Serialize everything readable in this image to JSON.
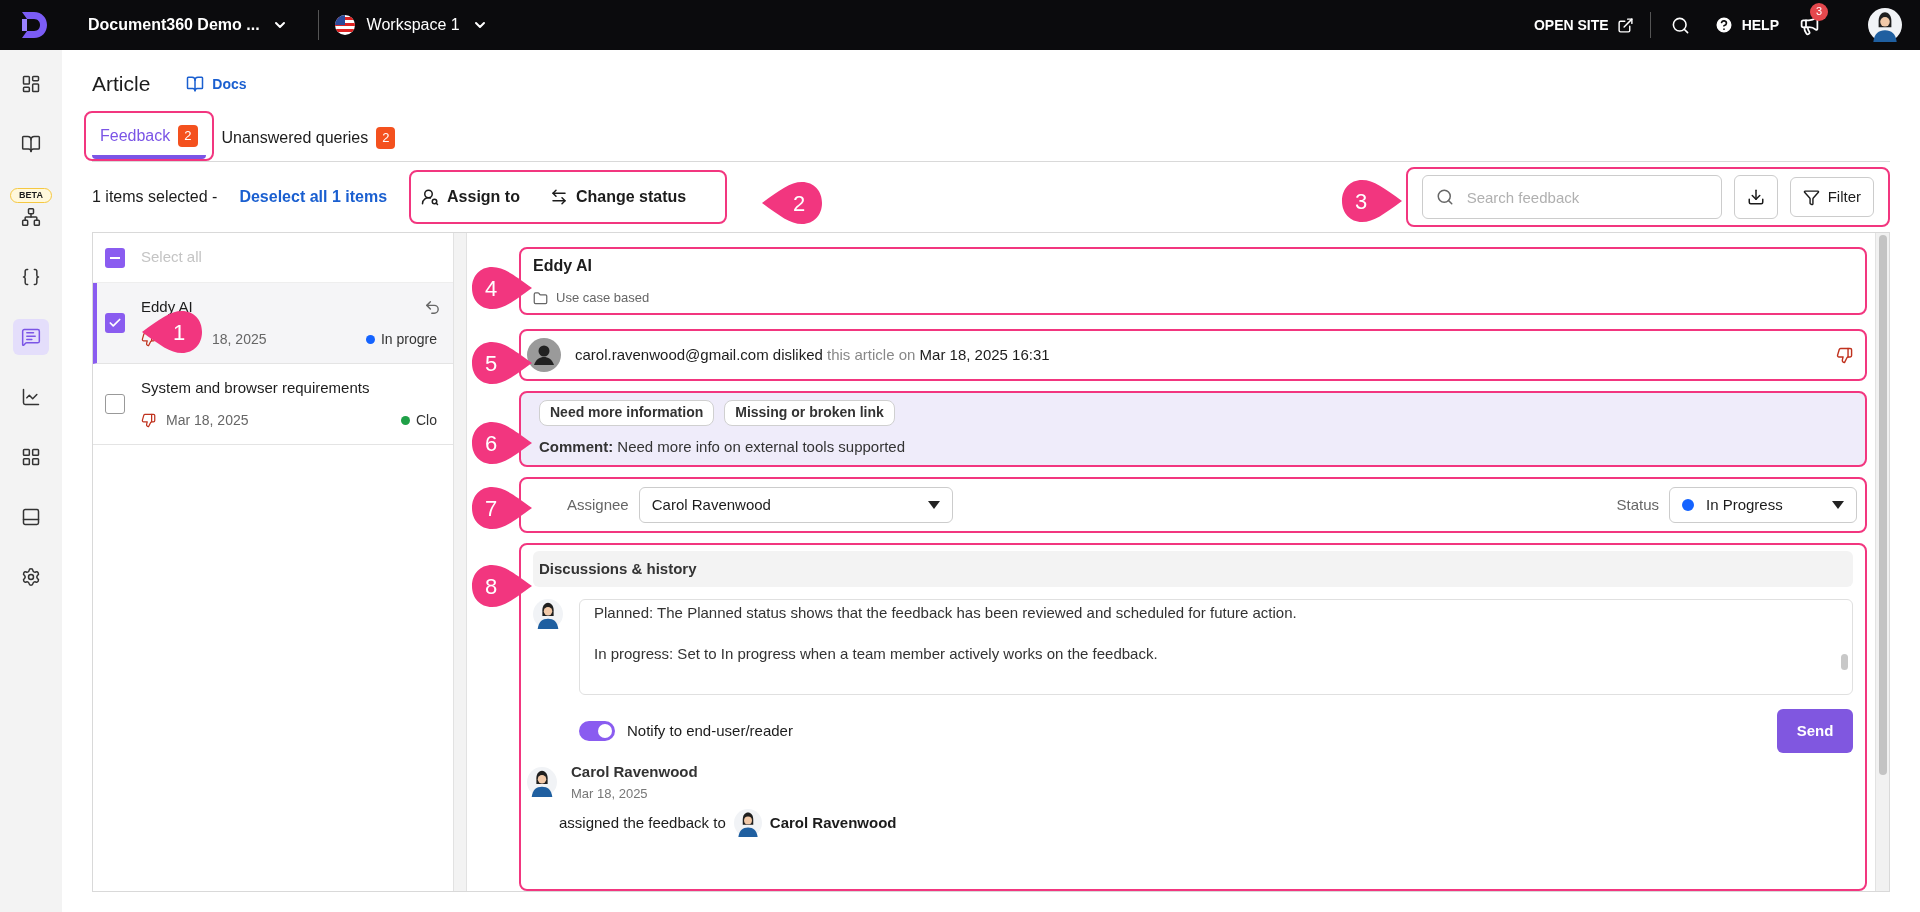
{
  "top_bar": {
    "project": "Document360 Demo ...",
    "workspace": "Workspace 1",
    "open_site": "OPEN SITE",
    "help": "HELP",
    "notifications_badge": "3"
  },
  "sidebar": {
    "beta": "BETA",
    "items": [
      {
        "kind": "dashboard",
        "selected": false
      },
      {
        "kind": "docs",
        "selected": false
      },
      {
        "kind": "workflow",
        "selected": false
      },
      {
        "kind": "api",
        "selected": false
      },
      {
        "kind": "feedback",
        "selected": true
      },
      {
        "kind": "analytics",
        "selected": false
      },
      {
        "kind": "apps",
        "selected": false
      },
      {
        "kind": "widget",
        "selected": false
      },
      {
        "kind": "settings",
        "selected": false
      }
    ]
  },
  "page": {
    "title": "Article",
    "docs_link": "Docs"
  },
  "tabs": [
    {
      "label": "Feedback",
      "count": "2",
      "selected": true,
      "highlighted": true
    },
    {
      "label": "Unanswered queries",
      "count": "2",
      "selected": false,
      "highlighted": false
    }
  ],
  "toolbar": {
    "selection": "1 items selected -",
    "deselect": "Deselect all 1 items",
    "assign": "Assign to",
    "change_status": "Change status",
    "search_placeholder": "Search feedback",
    "filter": "Filter"
  },
  "list": {
    "select_all": "Select all",
    "indeterminate": true,
    "items": [
      {
        "title": "Eddy AI",
        "date": "18, 2025",
        "status": "In progre",
        "color": "#1463ff",
        "checked": true,
        "selected": true
      },
      {
        "title": "System and browser requirements",
        "date": "Mar 18, 2025",
        "status": "Clo",
        "color": "#1fa047",
        "checked": false,
        "selected": false
      }
    ]
  },
  "detail": {
    "title": "Eddy AI",
    "category": "Use case based",
    "reviewer": "carol.ravenwood@gmail.com",
    "action": "disliked",
    "middle": "this article on",
    "datetime": "Mar 18, 2025 16:31",
    "reasons": [
      "Need more information",
      "Missing or broken link"
    ],
    "comment_label": "Comment:",
    "comment": "Need more info on external tools supported",
    "assignee_label": "Assignee",
    "assignee": "Carol Ravenwood",
    "status_label": "Status",
    "status": "In Progress",
    "color": "#1463ff"
  },
  "discussion": {
    "title": "Discussions & history",
    "editor_lines": [
      "Planned: The Planned status shows that the feedback has been reviewed and scheduled for future action.",
      "In progress: Set to In progress when a team member actively works on the feedback."
    ],
    "notify": {
      "label": "Notify to end-user/reader",
      "on": true
    },
    "send": "Send",
    "history": [
      {
        "author": "Carol Ravenwood",
        "date": "Mar 18, 2025",
        "text": "assigned the feedback to",
        "target": "Carol Ravenwood"
      }
    ]
  },
  "callouts": [
    {
      "number": "1",
      "kind": "left"
    },
    {
      "number": "2",
      "kind": "left"
    },
    {
      "number": "3",
      "kind": "right"
    },
    {
      "number": "4",
      "kind": "right"
    },
    {
      "number": "5",
      "kind": "right"
    },
    {
      "number": "6",
      "kind": "right"
    },
    {
      "number": "7",
      "kind": "right"
    },
    {
      "number": "8",
      "kind": "right"
    }
  ]
}
